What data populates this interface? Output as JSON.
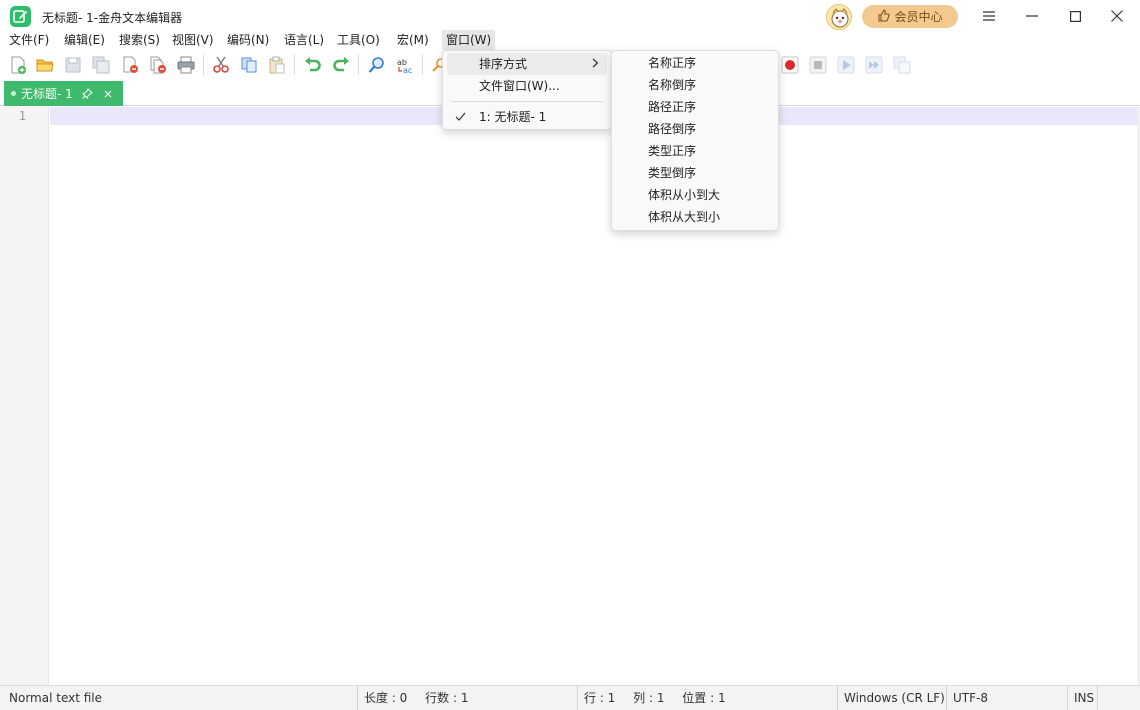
{
  "window": {
    "title": "无标题- 1-金舟文本编辑器",
    "vip_label": "会员中心",
    "controls": [
      "menu-icon",
      "minimize-icon",
      "maximize-icon",
      "close-icon"
    ],
    "accent_color": "#2ebd6b"
  },
  "menubar": {
    "items": [
      {
        "label": "文件(F)"
      },
      {
        "label": "编辑(E)"
      },
      {
        "label": "搜索(S)"
      },
      {
        "label": "视图(V)"
      },
      {
        "label": "编码(N)"
      },
      {
        "label": "语言(L)"
      },
      {
        "label": "工具(O)"
      },
      {
        "label": "宏(M)"
      },
      {
        "label": "窗口(W)"
      }
    ]
  },
  "window_menu": {
    "items": [
      {
        "label": "排序方式",
        "has_submenu": true
      },
      {
        "label": "文件窗口(W)..."
      },
      {
        "label": "1: 无标题- 1",
        "checked": true
      }
    ]
  },
  "sort_submenu": {
    "items": [
      {
        "label": "名称正序"
      },
      {
        "label": "名称倒序"
      },
      {
        "label": "路径正序"
      },
      {
        "label": "路径倒序"
      },
      {
        "label": "类型正序"
      },
      {
        "label": "类型倒序"
      },
      {
        "label": "体积从小到大"
      },
      {
        "label": "体积从大到小"
      }
    ]
  },
  "tab": {
    "label": "无标题- 1",
    "color": "#3fb96b"
  },
  "editor": {
    "line_numbers": [
      "1"
    ]
  },
  "statusbar": {
    "file_type": "Normal text file",
    "length": "长度 : 0",
    "lines": "行数 : 1",
    "row": "行 : 1",
    "col": "列 : 1",
    "pos": "位置 : 1",
    "eol": "Windows (CR LF)",
    "encoding": "UTF-8",
    "mode": "INS"
  }
}
